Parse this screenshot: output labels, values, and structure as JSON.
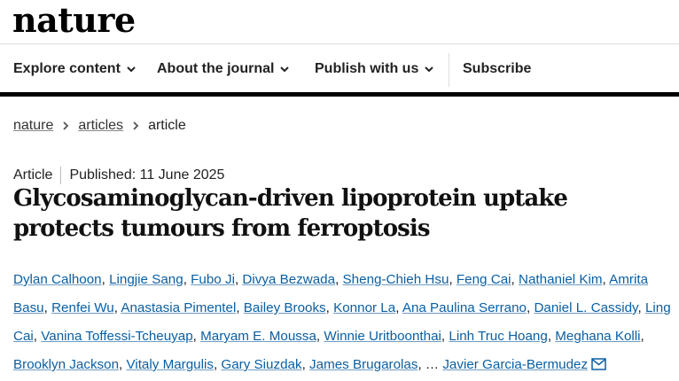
{
  "site": {
    "logo": "nature"
  },
  "nav": {
    "items": [
      {
        "label": "Explore content"
      },
      {
        "label": "About the journal"
      },
      {
        "label": "Publish with us"
      }
    ],
    "subscribe": "Subscribe"
  },
  "breadcrumb": [
    {
      "label": "nature"
    },
    {
      "label": "articles"
    },
    {
      "label": "article"
    }
  ],
  "article": {
    "type": "Article",
    "published": "Published: 11 June 2025",
    "title": "Glycosaminoglycan-driven lipoprotein uptake protects tumours from ferroptosis",
    "authors": [
      "Dylan Calhoon",
      "Lingjie Sang",
      "Fubo Ji",
      "Divya Bezwada",
      "Sheng-Chieh Hsu",
      "Feng Cai",
      "Nathaniel Kim",
      "Amrita Basu",
      "Renfei Wu",
      "Anastasia Pimentel",
      "Bailey Brooks",
      "Konnor La",
      "Ana Paulina Serrano",
      "Daniel L. Cassidy",
      "Ling Cai",
      "Vanina Toffessi-Tcheuyap",
      "Maryam E. Moussa",
      "Winnie Uritboonthai",
      "Linh Truc Hoang",
      "Meghana Kolli",
      "Brooklyn Jackson",
      "Vitaly Margulis",
      "Gary Siuzdak",
      "James Brugarolas"
    ],
    "ellipsis": "…",
    "corresponding_author": "Javier Garcia-Bermudez",
    "icons": {
      "mail": "mail-icon",
      "chevron": "chevron-down-icon",
      "breadcrumb_sep": "chevron-right-icon"
    }
  }
}
